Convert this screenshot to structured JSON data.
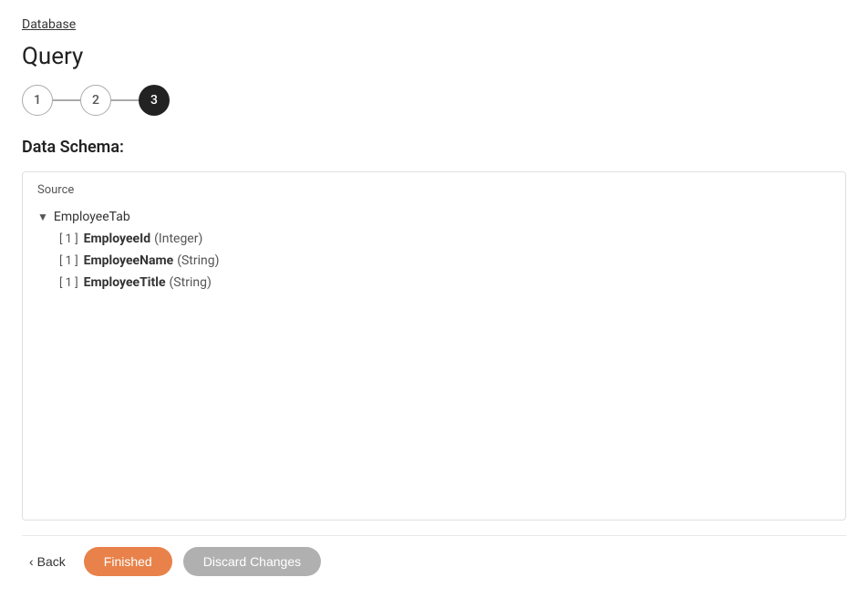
{
  "breadcrumb": {
    "label": "Database"
  },
  "page": {
    "title": "Query"
  },
  "stepper": {
    "steps": [
      {
        "number": "1",
        "state": "inactive"
      },
      {
        "number": "2",
        "state": "inactive"
      },
      {
        "number": "3",
        "state": "active"
      }
    ]
  },
  "schema_section": {
    "label": "Data Schema:",
    "source_label": "Source",
    "tree": {
      "parent_name": "EmployeeTab",
      "children": [
        {
          "index": "[ 1 ]",
          "name": "EmployeeId",
          "type": "(Integer)"
        },
        {
          "index": "[ 1 ]",
          "name": "EmployeeName",
          "type": "(String)"
        },
        {
          "index": "[ 1 ]",
          "name": "EmployeeTitle",
          "type": "(String)"
        }
      ]
    }
  },
  "footer": {
    "back_label": "Back",
    "finished_label": "Finished",
    "discard_label": "Discard Changes",
    "back_arrow": "‹"
  }
}
